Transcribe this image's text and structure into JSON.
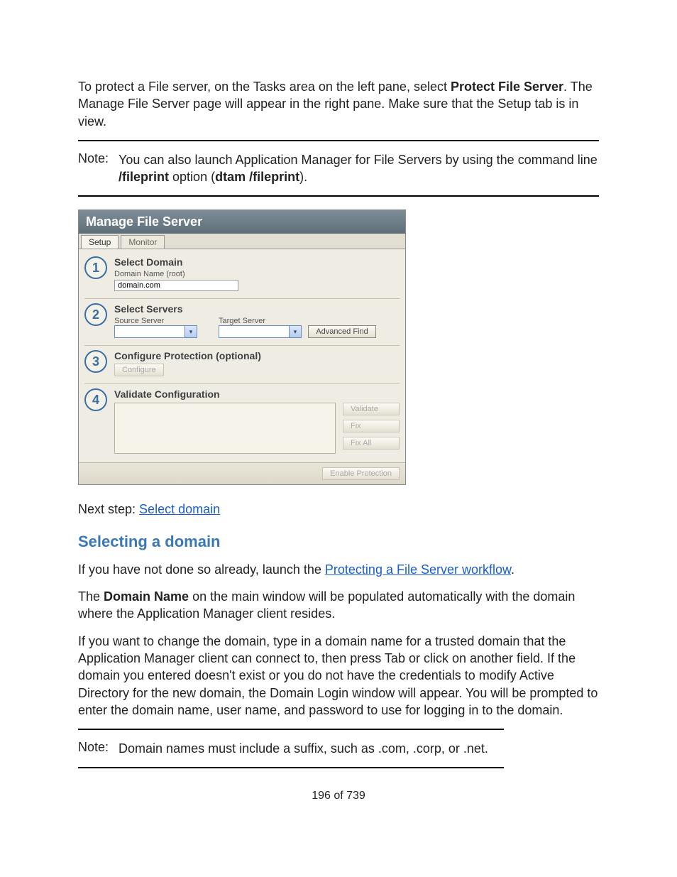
{
  "intro": {
    "p1_a": "To protect a File server, on the Tasks area on the left pane, select ",
    "p1_b": "Protect File Server",
    "p1_c": ". The Manage File Server page will appear in the right pane. Make sure that the Setup tab is in view."
  },
  "note1": {
    "label": "Note:",
    "body_a": "You can also launch Application Manager for File Servers by using the command line ",
    "body_b": "/fileprint",
    "body_c": " option (",
    "body_d": "dtam /fileprint",
    "body_e": ")."
  },
  "panel": {
    "title": "Manage File Server",
    "tab_setup": "Setup",
    "tab_monitor": "Monitor",
    "step1": {
      "num": "1",
      "title": "Select Domain",
      "field_label": "Domain Name (root)",
      "field_value": "domain.com"
    },
    "step2": {
      "num": "2",
      "title": "Select Servers",
      "source_label": "Source Server",
      "target_label": "Target Server",
      "adv_find": "Advanced Find"
    },
    "step3": {
      "num": "3",
      "title": "Configure Protection (optional)",
      "configure_btn": "Configure"
    },
    "step4": {
      "num": "4",
      "title": "Validate Configuration",
      "validate_btn": "Validate",
      "fix_btn": "Fix",
      "fixall_btn": "Fix All"
    },
    "enable_btn": "Enable Protection"
  },
  "nextstep": {
    "prefix": "Next step: ",
    "link": "Select domain"
  },
  "section_heading": "Selecting a domain",
  "sec_p1_a": "If you have not done so already, launch the ",
  "sec_p1_link": "Protecting a File Server workflow",
  "sec_p1_b": ".",
  "sec_p2_a": "The ",
  "sec_p2_b": "Domain Name",
  "sec_p2_c": " on the main window will be populated automatically with the domain where the Application Manager client resides.",
  "sec_p3": "If you want to change the domain, type in a domain name for a trusted domain that the Application Manager client can connect to, then press Tab or click on another field. If the domain you entered doesn't exist or you do not have the credentials to modify Active Directory for the new domain, the Domain Login window will appear. You will be prompted to enter the domain name, user name, and password to use for logging in to the domain.",
  "note2": {
    "label": "Note:",
    "body": "Domain names must include a suffix, such as .com, .corp, or .net."
  },
  "pagenum": "196 of 739"
}
